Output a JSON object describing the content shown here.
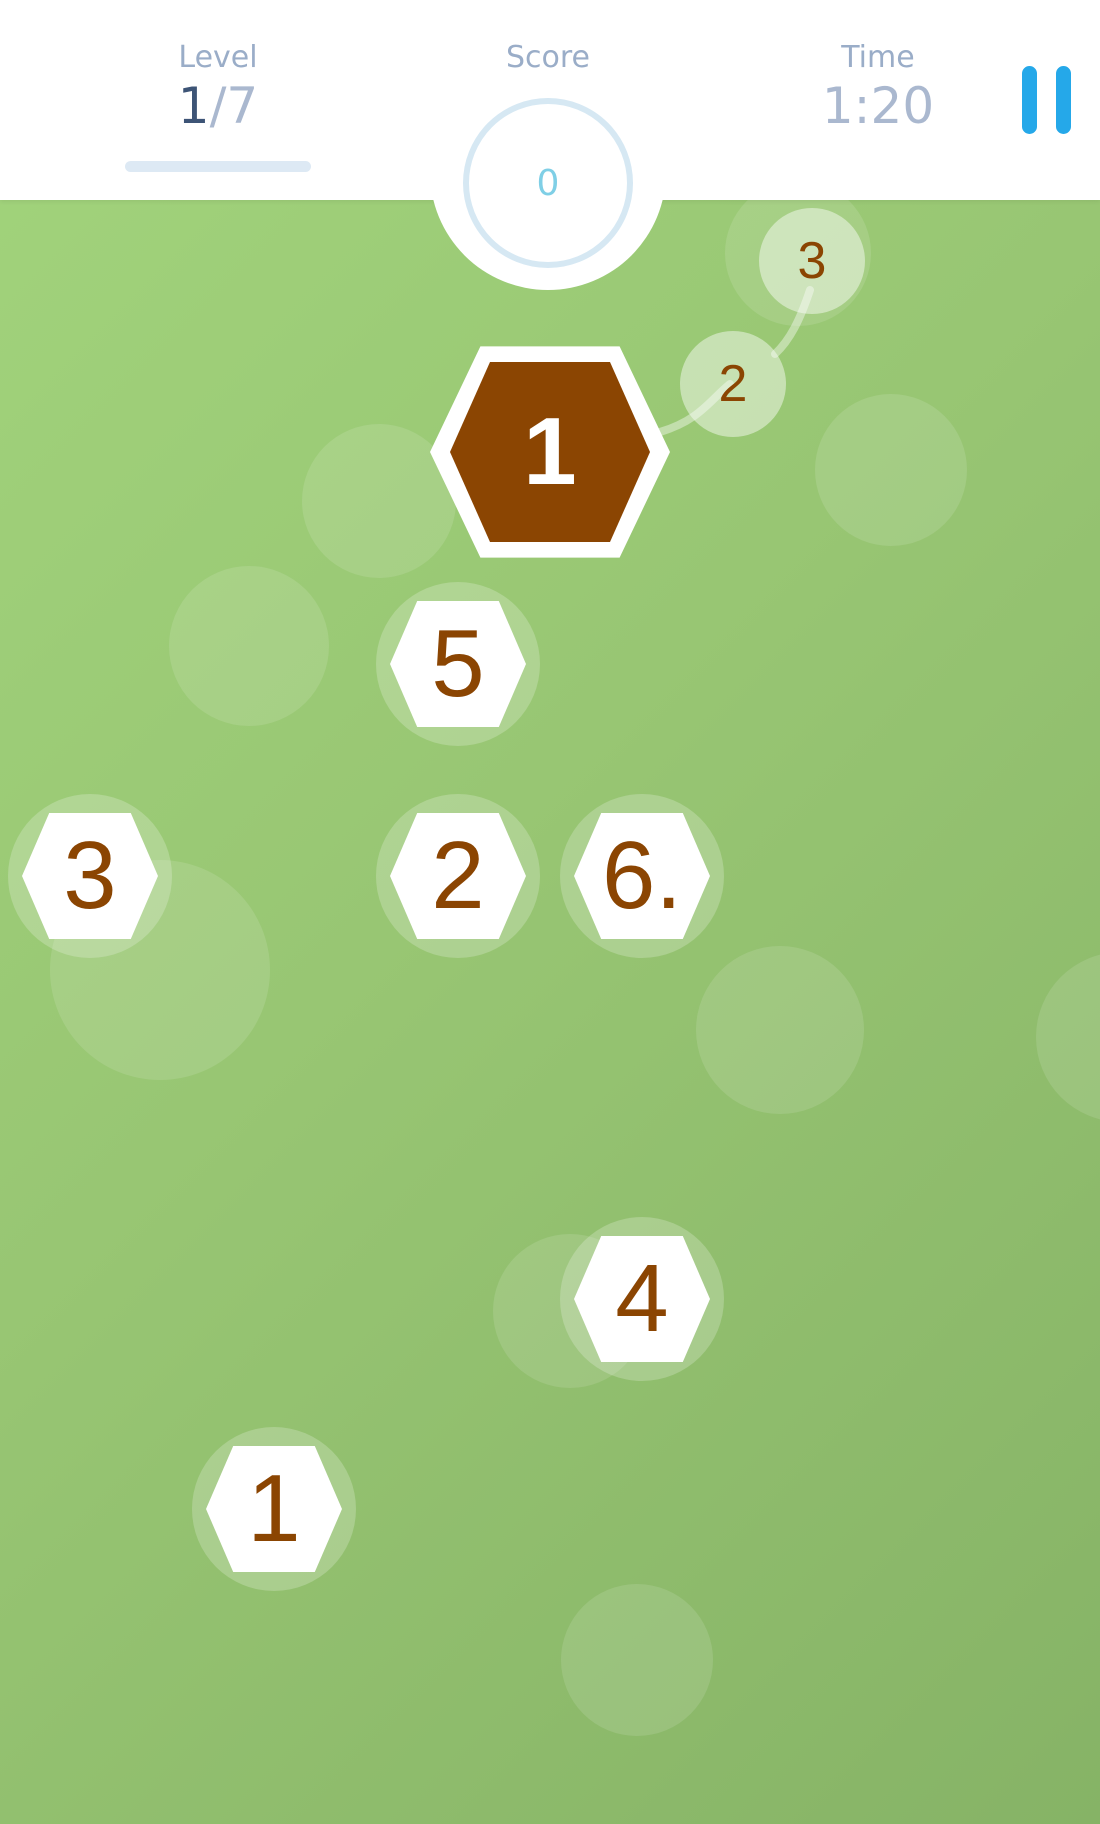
{
  "header": {
    "level": {
      "label": "Level",
      "current": "1",
      "separator": "/",
      "total": "7"
    },
    "score": {
      "label": "Score",
      "value": "0"
    },
    "time": {
      "label": "Time",
      "value": "1:20"
    },
    "pause_icon": "pause-icon"
  },
  "board": {
    "active_tile": {
      "label": "1"
    },
    "queue": [
      {
        "label": "2"
      },
      {
        "label": "3"
      }
    ],
    "tiles": [
      {
        "label": "5"
      },
      {
        "label": "3"
      },
      {
        "label": "2"
      },
      {
        "label": "6."
      },
      {
        "label": "4"
      },
      {
        "label": "1"
      }
    ]
  },
  "colors": {
    "background_light": "#a2d47c",
    "background_dark": "#86b366",
    "tile_text": "#8b4502",
    "active_tile_fill": "#8b4502",
    "pause_accent": "#25a8e9"
  }
}
